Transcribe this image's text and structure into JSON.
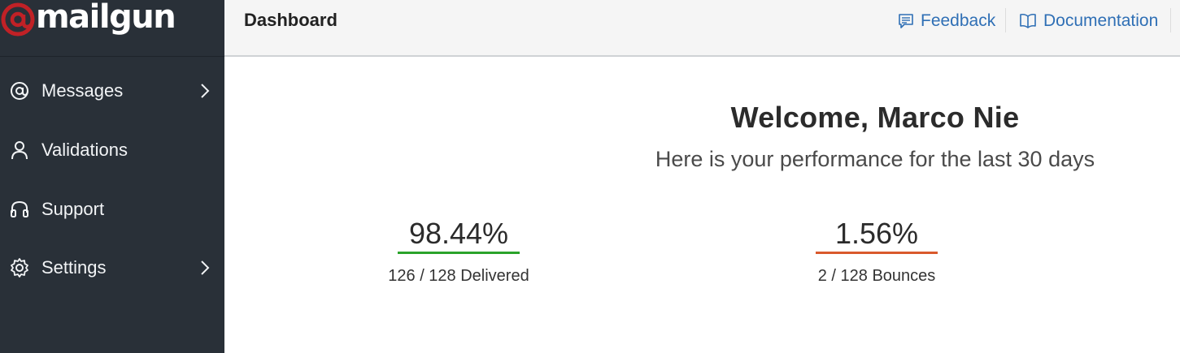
{
  "app": {
    "logo_text": "mailgun",
    "brand_color": "#c02126"
  },
  "sidebar": {
    "items": [
      {
        "label": "Messages",
        "icon": "at-icon",
        "has_chevron": true
      },
      {
        "label": "Validations",
        "icon": "user-icon",
        "has_chevron": false
      },
      {
        "label": "Support",
        "icon": "headset-icon",
        "has_chevron": false
      },
      {
        "label": "Settings",
        "icon": "gear-icon",
        "has_chevron": true
      }
    ]
  },
  "header": {
    "title": "Dashboard",
    "feedback_label": "Feedback",
    "documentation_label": "Documentation",
    "link_color": "#2f6fb5"
  },
  "main": {
    "welcome_title": "Welcome, Marco Nie",
    "welcome_subtitle": "Here is your performance for the last 30 days",
    "stats": [
      {
        "value": "98.44%",
        "label": "126 / 128 Delivered",
        "color": "#2aa32a"
      },
      {
        "value": "1.56%",
        "label": "2 / 128 Bounces",
        "color": "#d9592c"
      }
    ]
  }
}
